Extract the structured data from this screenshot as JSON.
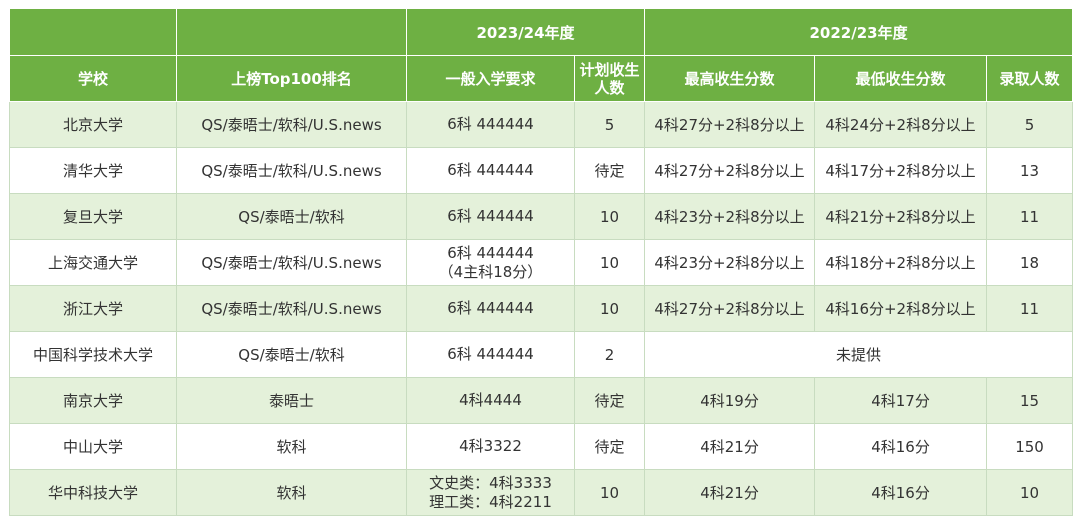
{
  "header": {
    "year_2324": "2023/24年度",
    "year_2223": "2022/23年度",
    "col_school": "学校",
    "col_ranking": "上榜Top100排名",
    "col_requirement": "一般入学要求",
    "col_plan_line1": "计划收生",
    "col_plan_line2": "人数",
    "col_max": "最高收生分数",
    "col_min": "最低收生分数",
    "col_admitted": "录取人数"
  },
  "rows": [
    {
      "school": "北京大学",
      "ranking": "QS/泰晤士/软科/U.S.news",
      "req": [
        "6科 444444"
      ],
      "plan": "5",
      "max": "4科27分+2科8分以上",
      "min": "4科24分+2科8分以上",
      "admitted": "5"
    },
    {
      "school": "清华大学",
      "ranking": "QS/泰晤士/软科/U.S.news",
      "req": [
        "6科 444444"
      ],
      "plan": "待定",
      "max": "4科27分+2科8分以上",
      "min": "4科17分+2科8分以上",
      "admitted": "13"
    },
    {
      "school": "复旦大学",
      "ranking": "QS/泰晤士/软科",
      "req": [
        "6科 444444"
      ],
      "plan": "10",
      "max": "4科23分+2科8分以上",
      "min": "4科21分+2科8分以上",
      "admitted": "11"
    },
    {
      "school": "上海交通大学",
      "ranking": "QS/泰晤士/软科/U.S.news",
      "req": [
        "6科 444444",
        "（4主科18分）"
      ],
      "plan": "10",
      "max": "4科23分+2科8分以上",
      "min": "4科18分+2科8分以上",
      "admitted": "18"
    },
    {
      "school": "浙江大学",
      "ranking": "QS/泰晤士/软科/U.S.news",
      "req": [
        "6科 444444"
      ],
      "plan": "10",
      "max": "4科27分+2科8分以上",
      "min": "4科16分+2科8分以上",
      "admitted": "11"
    },
    {
      "school": "中国科学技术大学",
      "ranking": "QS/泰晤士/软科",
      "req": [
        "6科 444444"
      ],
      "plan": "2",
      "merged": "未提供"
    },
    {
      "school": "南京大学",
      "ranking": "泰晤士",
      "req": [
        "4科4444"
      ],
      "plan": "待定",
      "max": "4科19分",
      "min": "4科17分",
      "admitted": "15"
    },
    {
      "school": "中山大学",
      "ranking": "软科",
      "req": [
        "4科3322"
      ],
      "plan": "待定",
      "max": "4科21分",
      "min": "4科16分",
      "admitted": "150"
    },
    {
      "school": "华中科技大学",
      "ranking": "软科",
      "req": [
        "文史类：4科3333",
        "理工类：4科2211"
      ],
      "plan": "10",
      "max": "4科21分",
      "min": "4科16分",
      "admitted": "10"
    }
  ]
}
